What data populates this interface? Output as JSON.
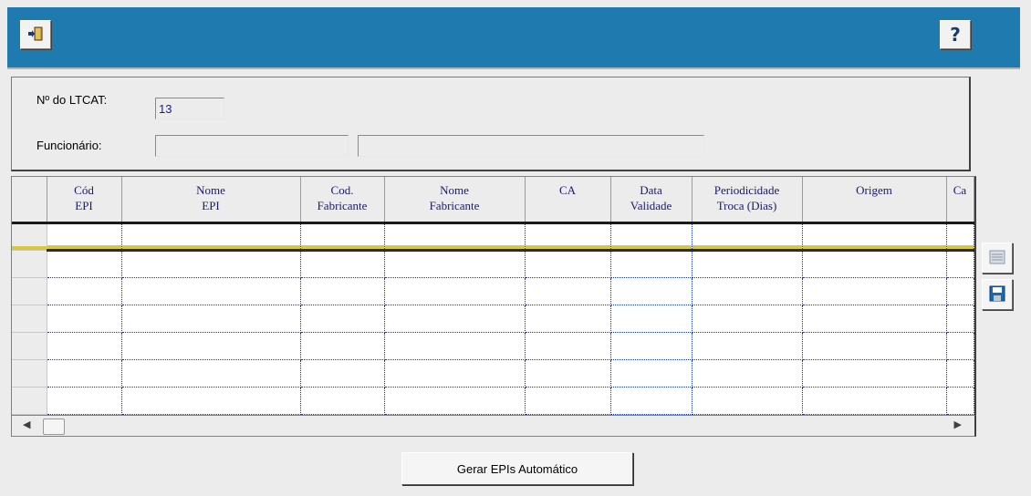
{
  "toolbar": {
    "exit_icon": "exit-door-icon",
    "help_label": "?"
  },
  "form": {
    "ltcat_label": "Nº do LTCAT:",
    "ltcat_value": "13",
    "funcionario_label": "Funcionário:",
    "funcionario_code": "",
    "funcionario_name": ""
  },
  "grid": {
    "columns": [
      {
        "line1": "Cód",
        "line2": "EPI"
      },
      {
        "line1": "Nome",
        "line2": "EPI"
      },
      {
        "line1": "Cod.",
        "line2": "Fabricante"
      },
      {
        "line1": "Nome",
        "line2": "Fabricante"
      },
      {
        "line1": "CA",
        "line2": ""
      },
      {
        "line1": "Data",
        "line2": "Validade"
      },
      {
        "line1": "Periodicidade",
        "line2": "Troca (Dias)"
      },
      {
        "line1": "Origem",
        "line2": ""
      },
      {
        "line1": "Ca",
        "line2": ""
      }
    ],
    "rows": 7
  },
  "side_buttons": {
    "list_icon": "list-icon",
    "save_icon": "save-icon"
  },
  "actions": {
    "generate_label": "Gerar EPIs Automático"
  },
  "colors": {
    "header_bar": "#1f7ab0",
    "grid_dotted": "#1a3aa0",
    "column_text": "#1a1a6a"
  }
}
